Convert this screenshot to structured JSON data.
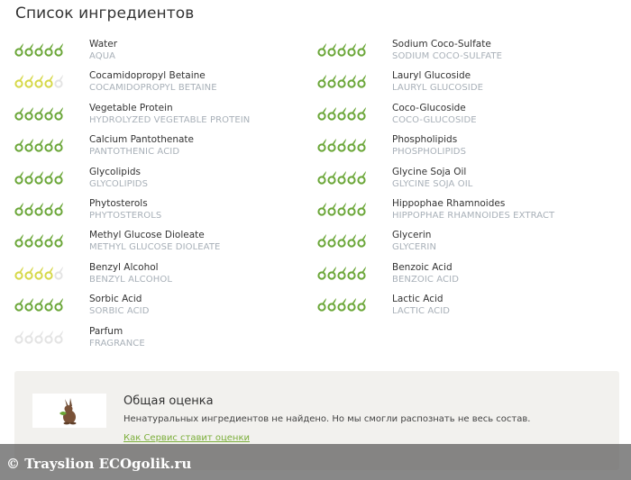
{
  "page": {
    "title": "Список ингредиентов"
  },
  "colors": {
    "good": "#6aa637",
    "medium": "#d6d848",
    "none": "#e3e3e3"
  },
  "ingredients_left": [
    {
      "name": "Water",
      "latin": "AQUA",
      "level": "good",
      "rating": 5
    },
    {
      "name": "Cocamidopropyl Betaine",
      "latin": "COCAMIDOPROPYL BETAINE",
      "level": "medium",
      "rating": 4
    },
    {
      "name": "Vegetable Protein",
      "latin": "HYDROLYZED VEGETABLE PROTEIN",
      "level": "good",
      "rating": 5
    },
    {
      "name": "Calcium Pantothenate",
      "latin": "PANTOTHENIC ACID",
      "level": "good",
      "rating": 5
    },
    {
      "name": "Glycolipids",
      "latin": "GLYCOLIPIDS",
      "level": "good",
      "rating": 5
    },
    {
      "name": "Phytosterols",
      "latin": "PHYTOSTEROLS",
      "level": "good",
      "rating": 5
    },
    {
      "name": "Methyl Glucose Dioleate",
      "latin": "METHYL GLUCOSE DIOLEATE",
      "level": "good",
      "rating": 5
    },
    {
      "name": "Benzyl Alcohol",
      "latin": "BENZYL ALCOHOL",
      "level": "medium",
      "rating": 4
    },
    {
      "name": "Sorbic Acid",
      "latin": "SORBIC ACID",
      "level": "good",
      "rating": 5
    },
    {
      "name": "Parfum",
      "latin": "FRAGRANCE",
      "level": "none",
      "rating": 0
    }
  ],
  "ingredients_right": [
    {
      "name": "Sodium Coco-Sulfate",
      "latin": "SODIUM COCO-SULFATE",
      "level": "good",
      "rating": 5
    },
    {
      "name": "Lauryl Glucoside",
      "latin": "LAURYL GLUCOSIDE",
      "level": "good",
      "rating": 5
    },
    {
      "name": "Coco-Glucoside",
      "latin": "COCO-GLUCOSIDE",
      "level": "good",
      "rating": 5
    },
    {
      "name": "Phospholipids",
      "latin": "PHOSPHOLIPIDS",
      "level": "good",
      "rating": 5
    },
    {
      "name": "Glycine Soja Oil",
      "latin": "GLYCINE SOJA OIL",
      "level": "good",
      "rating": 5
    },
    {
      "name": "Hippophae Rhamnoides",
      "latin": "HIPPOPHAE RHAMNOIDES EXTRACT",
      "level": "good",
      "rating": 5
    },
    {
      "name": "Glycerin",
      "latin": "GLYCERIN",
      "level": "good",
      "rating": 5
    },
    {
      "name": "Benzoic Acid",
      "latin": "BENZOIC ACID",
      "level": "good",
      "rating": 5
    },
    {
      "name": "Lactic Acid",
      "latin": "LACTIC ACID",
      "level": "good",
      "rating": 5
    }
  ],
  "summary": {
    "title": "Общая оценка",
    "text": "Ненатуральных ингредиентов не найдено. Но мы смогли распознать не весь состав.",
    "link": "Как Сервис ставит оценки",
    "logo_icon": "rabbit-icon"
  },
  "watermark": {
    "text": "© Trayslion ECOgolik.ru"
  }
}
